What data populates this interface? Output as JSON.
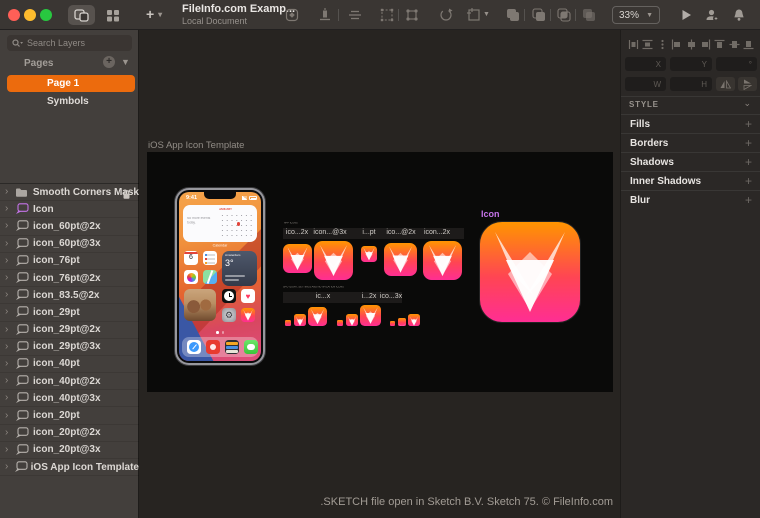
{
  "toolbar": {
    "title": "FileInfo.com Examp...",
    "subtitle": "Local Document",
    "zoom_level": "33%",
    "icons": [
      "symbol-diamond-icon",
      "align-layer-icon",
      "distribute-icon",
      "selection-icon",
      "transform-icon",
      "rotate-copies-icon",
      "frame-icon",
      "union-icon",
      "subtract-icon",
      "intersect-icon",
      "difference-icon",
      "play-icon",
      "account-icon",
      "notifications-icon"
    ],
    "window_controls": [
      "close",
      "minimize",
      "zoom"
    ],
    "panel_toggles": [
      "toggle-left-panels",
      "toggle-right-panels"
    ]
  },
  "left_sidebar": {
    "search_placeholder": "Search Layers",
    "pages_header": "Pages",
    "pages": [
      {
        "name": "Page 1",
        "selected": true
      },
      {
        "name": "Symbols",
        "selected": false
      }
    ],
    "layers": [
      {
        "name": "Smooth Corners Mask",
        "icon": "folder-icon",
        "locked": true
      },
      {
        "name": "Icon",
        "icon": "symbol-icon",
        "color": "purple"
      },
      {
        "name": "icon_60pt@2x",
        "icon": "symbol-icon"
      },
      {
        "name": "icon_60pt@3x",
        "icon": "symbol-icon"
      },
      {
        "name": "icon_76pt",
        "icon": "symbol-icon"
      },
      {
        "name": "icon_76pt@2x",
        "icon": "symbol-icon"
      },
      {
        "name": "icon_83.5@2x",
        "icon": "symbol-icon"
      },
      {
        "name": "icon_29pt",
        "icon": "symbol-icon"
      },
      {
        "name": "icon_29pt@2x",
        "icon": "symbol-icon"
      },
      {
        "name": "icon_29pt@3x",
        "icon": "symbol-icon"
      },
      {
        "name": "icon_40pt",
        "icon": "symbol-icon"
      },
      {
        "name": "icon_40pt@2x",
        "icon": "symbol-icon"
      },
      {
        "name": "icon_40pt@3x",
        "icon": "symbol-icon"
      },
      {
        "name": "icon_20pt",
        "icon": "symbol-icon"
      },
      {
        "name": "icon_20pt@2x",
        "icon": "symbol-icon"
      },
      {
        "name": "icon_20pt@3x",
        "icon": "symbol-icon"
      },
      {
        "name": "iOS App Icon Template",
        "icon": "symbol-icon"
      }
    ]
  },
  "canvas": {
    "artboard_title": "iOS App Icon Template",
    "watermark": ".SKETCH file open in Sketch B.V. Sketch 75. © FileInfo.com",
    "symbol_label": "Icon",
    "groups": [
      {
        "caption": "APP ICONS",
        "labels": [
          "ico...2x",
          "icon...@3x",
          "i...pt",
          "ico...@2x",
          "icon...2x"
        ]
      },
      {
        "caption": "SPOTLIGHT, SETTINGS AND NOTIFICATION ICONS",
        "labels": [
          "ic...x",
          "i...2x",
          "ico...3x"
        ]
      }
    ],
    "phone": {
      "status_time": "9:41",
      "widget_note": "No more events today.",
      "widget_month": "JANUARY",
      "calendar_label": "Calendar",
      "weather_city": "Amsterdam",
      "weather_temp": "3°",
      "apps": [
        "calendar-app",
        "reminders-app",
        "photos-app",
        "maps-app",
        "clock-app",
        "health-app",
        "settings-app",
        "fox-app"
      ],
      "dock": [
        "safari-app",
        "music-app",
        "wallet-app",
        "messages-app"
      ]
    }
  },
  "right_sidebar": {
    "align_tools": [
      "distribute-horizontal",
      "distribute-vertical",
      "more-options",
      "align-left",
      "align-center-horizontal",
      "align-right",
      "align-top",
      "align-middle-vertical",
      "align-bottom"
    ],
    "fields": {
      "x": "X",
      "y": "Y",
      "rotation": "°",
      "width": "W",
      "height": "H"
    },
    "flip_tools": [
      "flip-horizontal",
      "flip-vertical"
    ],
    "style_header": "STYLE",
    "sections": [
      "Fills",
      "Borders",
      "Shadows",
      "Inner Shadows",
      "Blur"
    ]
  },
  "colors": {
    "accent_orange": "#EC6B0D",
    "symbol_purple": "#C473E8",
    "icon_gradient_top": "#FF9500",
    "icon_gradient_bottom": "#FF2E93",
    "traffic": [
      "#FF5F57",
      "#FEBC2E",
      "#28C840"
    ]
  }
}
